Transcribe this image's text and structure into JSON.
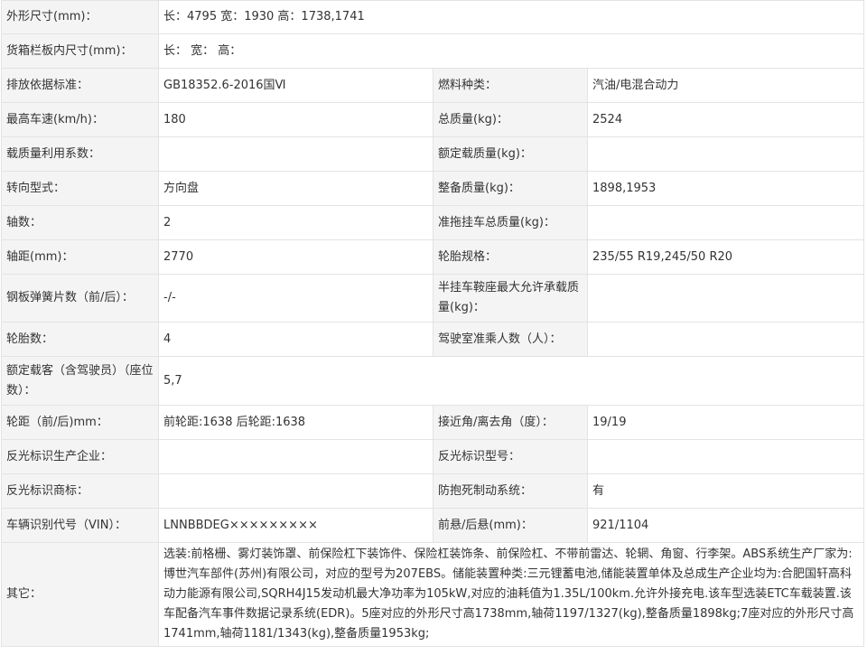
{
  "rows": [
    {
      "l1": "外形尺寸(mm)：",
      "v1": "长：4795 宽：1930 高：1738,1741"
    },
    {
      "l1": "货箱栏板内尺寸(mm)：",
      "v1": "长： 宽： 高："
    },
    {
      "l1": "排放依据标准：",
      "v1": "GB18352.6-2016国Ⅵ",
      "l2": "燃料种类：",
      "v2": "汽油/电混合动力"
    },
    {
      "l1": "最高车速(km/h)：",
      "v1": "180",
      "l2": "总质量(kg)：",
      "v2": "2524"
    },
    {
      "l1": "载质量利用系数：",
      "v1": "",
      "l2": "额定载质量(kg)：",
      "v2": ""
    },
    {
      "l1": "转向型式：",
      "v1": "方向盘",
      "l2": "整备质量(kg)：",
      "v2": "1898,1953"
    },
    {
      "l1": "轴数：",
      "v1": "2",
      "l2": "准拖挂车总质量(kg)：",
      "v2": ""
    },
    {
      "l1": "轴距(mm)：",
      "v1": "2770",
      "l2": "轮胎规格：",
      "v2": "235/55 R19,245/50 R20"
    },
    {
      "l1": "钢板弹簧片数（前/后）：",
      "v1": "-/-",
      "l2": "半挂车鞍座最大允许承载质量(kg)：",
      "v2": ""
    },
    {
      "l1": "轮胎数：",
      "v1": "4",
      "l2": "驾驶室准乘人数（人）：",
      "v2": ""
    },
    {
      "l1": "额定载客（含驾驶员）（座位数）：",
      "v1": "5,7"
    },
    {
      "l1": "轮距（前/后)mm：",
      "v1": "前轮距:1638 后轮距:1638",
      "l2": "接近角/离去角（度）：",
      "v2": "19/19"
    },
    {
      "l1": "反光标识生产企业：",
      "v1": "",
      "l2": "反光标识型号：",
      "v2": ""
    },
    {
      "l1": "反光标识商标：",
      "v1": "",
      "l2": "防抱死制动系统：",
      "v2": "有"
    },
    {
      "l1": "车辆识别代号（VIN）：",
      "v1": "LNNBBDEG×××××××××",
      "l2": "前悬/后悬(mm)：",
      "v2": "921/1104"
    },
    {
      "l1": "其它：",
      "v1": "选装:前格栅、雾灯装饰罩、前保险杠下装饰件、保险杠装饰条、前保险杠、不带前雷达、轮辋、角窗、行李架。ABS系统生产厂家为:博世汽车部件(苏州)有限公司，对应的型号为207EBS。储能装置种类:三元锂蓄电池,储能装置单体及总成生产企业均为:合肥国轩高科动力能源有限公司,SQRH4J15发动机最大净功率为105kW,对应的油耗值为1.35L/100km.允许外接充电.该车型选装ETC车载装置.该车配备汽车事件数据记录系统(EDR)。5座对应的外形尺寸高1738mm,轴荷1197/1327(kg),整备质量1898kg;7座对应的外形尺寸高1741mm,轴荷1181/1343(kg),整备质量1953kg;"
    }
  ]
}
